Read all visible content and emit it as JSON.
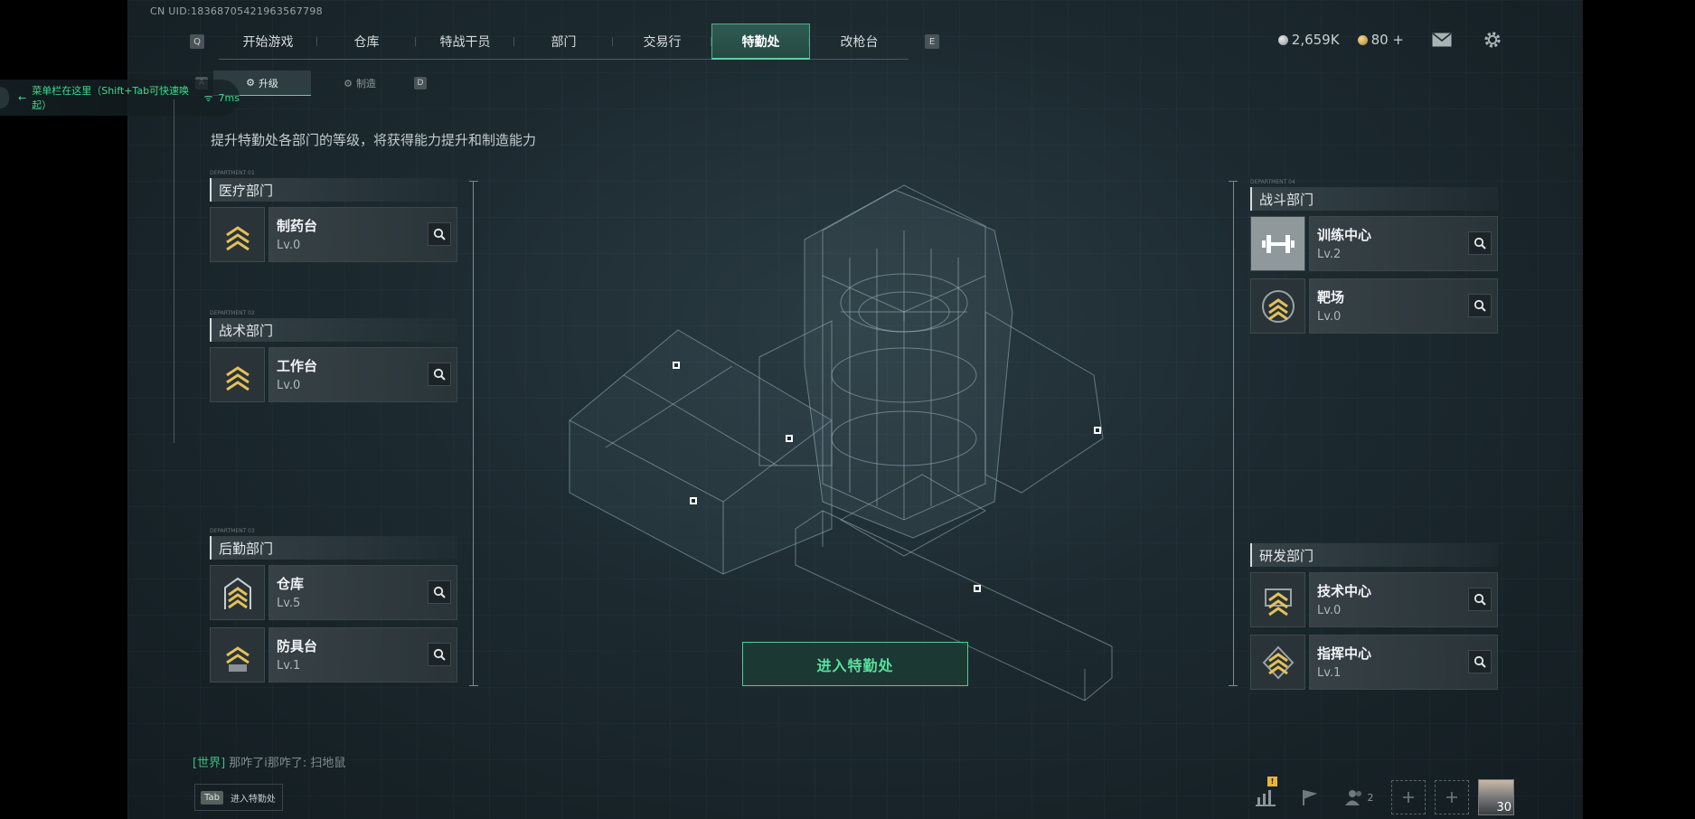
{
  "uid": "CN UID:1836870542196356779​8",
  "nav": {
    "left_key": "Q",
    "right_key": "E",
    "tabs": [
      "开始游戏",
      "仓库",
      "特战干员",
      "部门",
      "交易行",
      "特勤处",
      "改枪台"
    ],
    "active_index": 5
  },
  "currency": {
    "silver": "2,659K",
    "gold": "80 +"
  },
  "subnav": {
    "left_key": "A",
    "right_key": "D",
    "tabs": [
      {
        "label": "升级",
        "icon": "upgrade-icon"
      },
      {
        "label": "制造",
        "icon": "craft-icon"
      }
    ],
    "active_index": 0
  },
  "tip": {
    "text": "菜单栏在这里（Shift+Tab可快速唤起）",
    "ping": "7ms"
  },
  "description": "提升特勤处各部门的等级，将获得能力提升和制造能力",
  "departments": {
    "medical": {
      "tag": "DEPARTMENT 01",
      "title": "医疗部门",
      "facilities": [
        {
          "name": "制药台",
          "level": "Lv.0"
        }
      ]
    },
    "tactical": {
      "tag": "DEPARTMENT 02",
      "title": "战术部门",
      "facilities": [
        {
          "name": "工作台",
          "level": "Lv.0"
        }
      ]
    },
    "logistics": {
      "tag": "DEPARTMENT 03",
      "title": "后勤部门",
      "facilities": [
        {
          "name": "仓库",
          "level": "Lv.5"
        },
        {
          "name": "防具台",
          "level": "Lv.1"
        }
      ]
    },
    "combat": {
      "tag": "DEPARTMENT 04",
      "title": "战斗部门",
      "facilities": [
        {
          "name": "训练中心",
          "level": "Lv.2"
        },
        {
          "name": "靶场",
          "level": "Lv.0"
        }
      ]
    },
    "research": {
      "tag": "",
      "title": "研发部门",
      "facilities": [
        {
          "name": "技术中心",
          "level": "Lv.0"
        },
        {
          "name": "指挥中心",
          "level": "Lv.1"
        }
      ]
    }
  },
  "enter_button": "进入特勤处",
  "chat": {
    "channel": "[世界]",
    "message": "那咋了i那咋了: 扫地鼠"
  },
  "tab_hint": {
    "key": "Tab",
    "label": "进入特勤处"
  },
  "bottom": {
    "stats_badge": "!",
    "team_count": "2",
    "player_level": "30"
  },
  "colors": {
    "accent_green": "#59d1a2",
    "chevron_gold": "#e3c15a",
    "background": "#1c2a30"
  }
}
